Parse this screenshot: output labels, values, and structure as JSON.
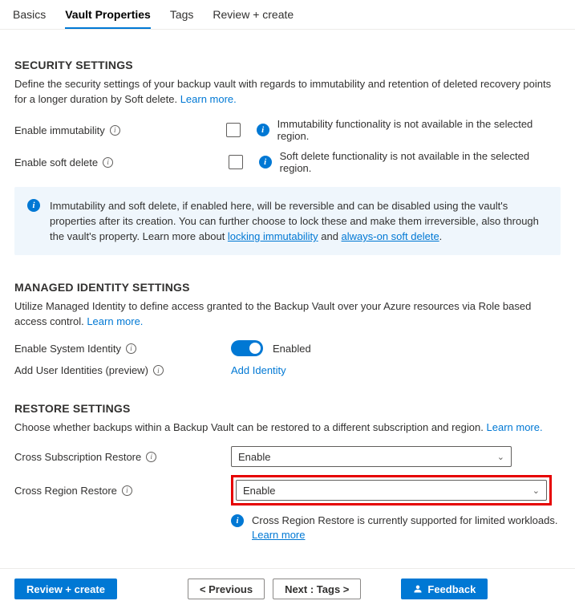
{
  "tabs": {
    "basics": "Basics",
    "vault_properties": "Vault Properties",
    "tags": "Tags",
    "review_create": "Review + create",
    "active": "vault_properties"
  },
  "security": {
    "title": "SECURITY SETTINGS",
    "desc": "Define the security settings of your backup vault with regards to immutability and retention of deleted recovery points for a longer duration by Soft delete. ",
    "learn_more": "Learn more.",
    "immutability_label": "Enable immutability",
    "immutability_msg": "Immutability functionality is not available in the selected region.",
    "softdelete_label": "Enable soft delete",
    "softdelete_msg": "Soft delete functionality is not available in the selected region.",
    "info_box_a": "Immutability and soft delete, if enabled here, will be reversible and can be disabled using the vault's properties after its creation. You can further choose to lock these and make them irreversible, also through the vault's property. Learn more about ",
    "info_box_link1": "locking immutability",
    "info_box_mid": " and ",
    "info_box_link2": "always-on soft delete",
    "info_box_end": "."
  },
  "identity": {
    "title": "MANAGED IDENTITY SETTINGS",
    "desc": "Utilize Managed Identity to define access granted to the Backup Vault over your Azure resources via Role based access control. ",
    "learn_more": "Learn more.",
    "system_identity_label": "Enable System Identity",
    "enabled_text": "Enabled",
    "add_user_label": "Add User Identities (preview)",
    "add_identity_link": "Add Identity"
  },
  "restore": {
    "title": "RESTORE SETTINGS",
    "desc": "Choose whether backups within a Backup Vault can be restored to a different subscription and region. ",
    "learn_more": "Learn more.",
    "csr_label": "Cross Subscription Restore",
    "csr_value": "Enable",
    "crr_label": "Cross Region Restore",
    "crr_value": "Enable",
    "crr_msg": "Cross Region Restore is currently supported for limited workloads. ",
    "crr_learn_more": "Learn more"
  },
  "footer": {
    "review_create": "Review + create",
    "previous": "< Previous",
    "next": "Next : Tags >",
    "feedback": "Feedback"
  }
}
